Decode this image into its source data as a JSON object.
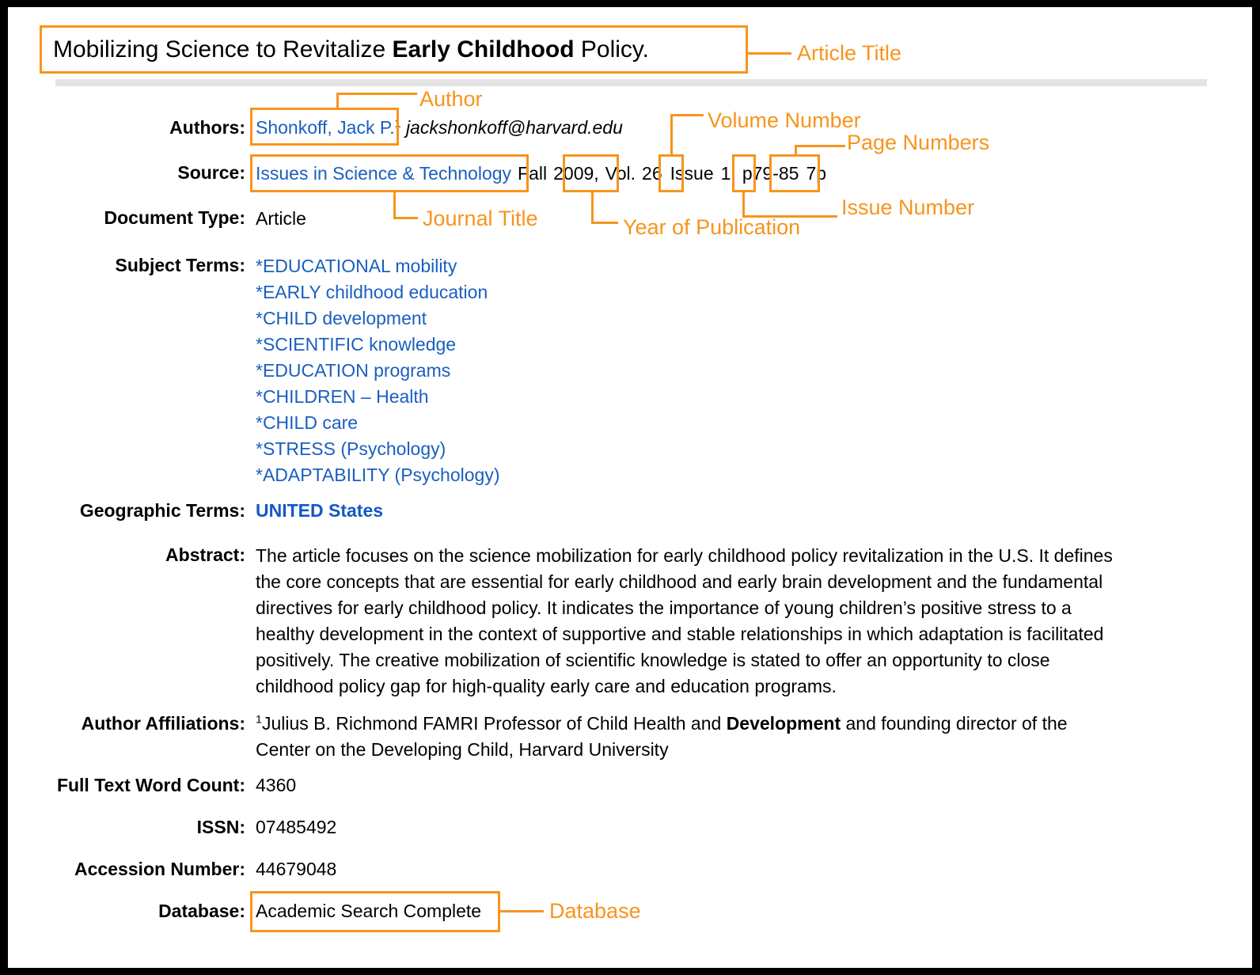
{
  "title": {
    "plain_before": "Mobilizing Science to Revitalize ",
    "bold": "Early Childhood",
    "plain_after": " Policy."
  },
  "record": {
    "authors": {
      "label": "Authors:",
      "name": "Shonkoff, Jack P.",
      "affiliation_marker": "1",
      "email": "jackshonkoff@harvard.edu"
    },
    "source": {
      "label": "Source:",
      "journal": "Issues in Science & Technology",
      "season": "Fall",
      "year": "2009,",
      "vol_word": "Vol.",
      "volume": "26",
      "issue_word": "Issue",
      "issue": "1,",
      "page_prefix": "p",
      "pages": "79-85",
      "page_count": "7p"
    },
    "document_type": {
      "label": "Document Type:",
      "value": "Article"
    },
    "subject_terms": {
      "label": "Subject Terms:",
      "items": [
        "*EDUCATIONAL mobility",
        "*EARLY childhood education",
        "*CHILD development",
        "*SCIENTIFIC knowledge",
        "*EDUCATION programs",
        "*CHILDREN – Health",
        "*CHILD care",
        "*STRESS (Psychology)",
        "*ADAPTABILITY (Psychology)"
      ]
    },
    "geographic_terms": {
      "label": "Geographic Terms:",
      "value": "UNITED States"
    },
    "abstract": {
      "label": "Abstract:",
      "lines": [
        "The article focuses on the science mobilization for early childhood policy revitalization in the U.S. It defines",
        "the core concepts that are essential for early childhood and early brain development and the fundamental",
        "directives for early childhood policy. It indicates the importance of young children’s positive stress to a",
        "healthy development in the context of supportive and stable relationships in which adaptation is facilitated",
        "positively. The creative mobilization of scientific knowledge is stated to offer an opportunity to close",
        "childhood policy gap for high-quality early care and education programs."
      ]
    },
    "author_affiliations": {
      "label": "Author Affiliations:",
      "marker": "1",
      "line1_a": "Julius B. Richmond FAMRI Professor of Child Health and ",
      "line1_bold": "Development",
      "line1_b": " and founding director of the",
      "line2": "Center on the Developing Child, Harvard University"
    },
    "full_text_word_count": {
      "label": "Full Text Word Count:",
      "value": "4360"
    },
    "issn": {
      "label": "ISSN:",
      "value": "07485492"
    },
    "accession_number": {
      "label": "Accession Number:",
      "value": "44679048"
    },
    "database": {
      "label": "Database:",
      "value": "Academic Search Complete"
    }
  },
  "annotations": {
    "article_title": "Article Title",
    "author": "Author",
    "volume_number": "Volume Number",
    "page_numbers": "Page Numbers",
    "issue_number": "Issue Number",
    "journal_title": "Journal Title",
    "year_of_publication": "Year of Publication",
    "database": "Database"
  },
  "colors": {
    "annotation_orange": "#f7941e",
    "link_blue": "#1a5fbf",
    "frame_black": "#000000",
    "divider_gray": "#e4e4e4"
  }
}
